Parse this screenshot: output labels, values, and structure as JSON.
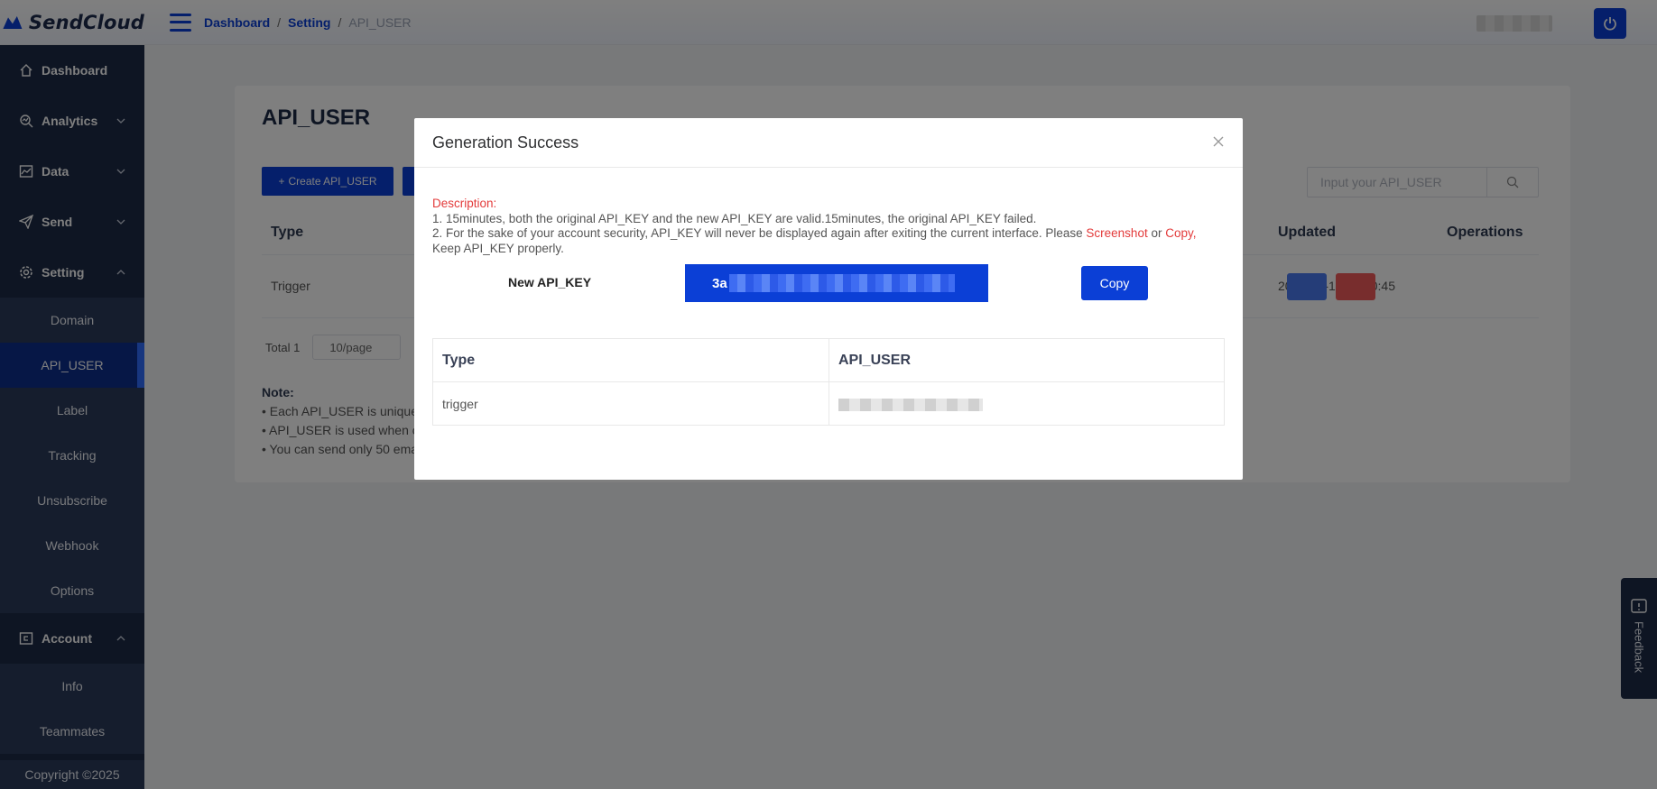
{
  "app": {
    "logo_text": "SendCloud",
    "brand_color": "#0b3fd6"
  },
  "breadcrumb": {
    "items": [
      "Dashboard",
      "Setting"
    ],
    "current": "API_USER",
    "separator": "/"
  },
  "sidebar": {
    "items": [
      {
        "label": "Dashboard",
        "icon": "home-icon"
      },
      {
        "label": "Analytics",
        "icon": "analytics-icon"
      },
      {
        "label": "Data",
        "icon": "chart-icon"
      },
      {
        "label": "Send",
        "icon": "send-icon"
      },
      {
        "label": "Setting",
        "icon": "gear-icon"
      },
      {
        "label": "Account",
        "icon": "account-icon"
      }
    ],
    "setting_sub": [
      "Domain",
      "API_USER",
      "Label",
      "Tracking",
      "Unsubscribe",
      "Webhook",
      "Options"
    ],
    "account_sub": [
      "Info",
      "Teammates"
    ],
    "active_sub": "API_USER",
    "copyright": "Copyright ©2025"
  },
  "page": {
    "title": "API_USER",
    "create_button": "Create API_USER",
    "search_placeholder": "Input your API_USER",
    "columns": {
      "type": "Type",
      "updated": "Updated",
      "operations": "Operations"
    },
    "row": {
      "type": "Trigger",
      "updated": "2025-05-12 18:20:45"
    },
    "pager": {
      "total": "Total 1",
      "page_size": "10/page"
    },
    "note": {
      "title": "Note:",
      "lines": [
        "• Each API_USER is unique",
        "• API_USER is used when c",
        "• You can send only 50 ema"
      ]
    }
  },
  "feedback": {
    "label": "Feedback"
  },
  "modal": {
    "title": "Generation Success",
    "description_label": "Description:",
    "line1": "1. 15minutes, both the original API_KEY and the new API_KEY are valid.15minutes, the original API_KEY failed.",
    "line2_start": "2. For the sake of your account security, API_KEY will never be displayed again after exiting the current interface. Please ",
    "line2_screenshot": "Screenshot",
    "line2_or": " or ",
    "line2_copy": "Copy,",
    "line3": "Keep API_KEY properly.",
    "key_label": "New API_KEY",
    "key_prefix": "3a",
    "copy_button": "Copy",
    "table": {
      "headers": [
        "Type",
        "API_USER"
      ],
      "row": {
        "type": "trigger"
      }
    }
  }
}
